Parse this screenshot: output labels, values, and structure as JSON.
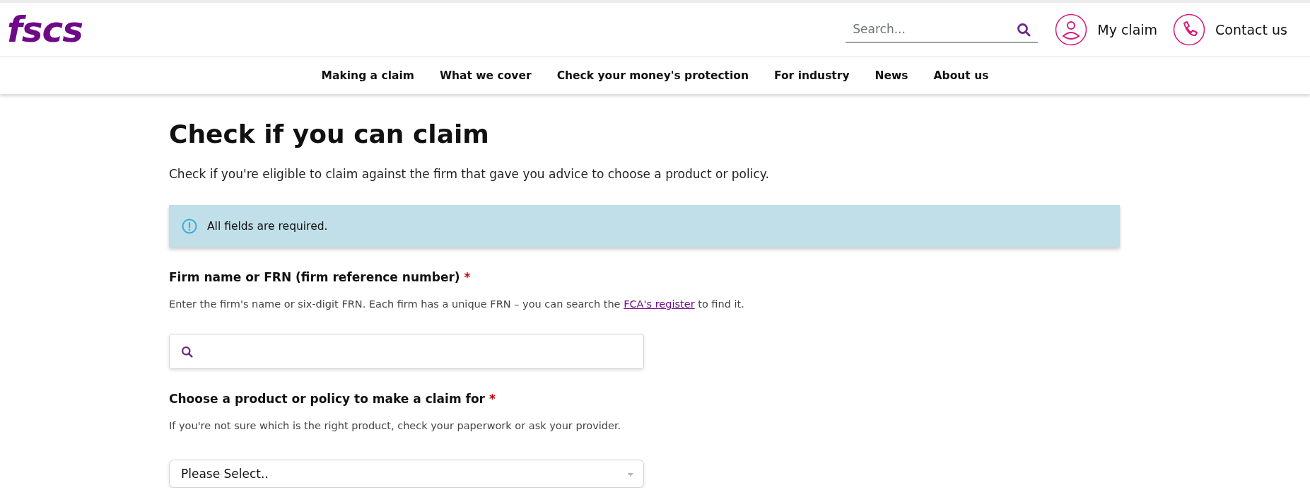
{
  "header": {
    "logo": "fscs",
    "search": {
      "placeholder": "Search..."
    },
    "actions": [
      {
        "kind": "person",
        "label": "My claim"
      },
      {
        "kind": "phone",
        "label": "Contact us"
      }
    ]
  },
  "nav": [
    "Making a claim",
    "What we cover",
    "Check your money's protection",
    "For industry",
    "News",
    "About us"
  ],
  "page": {
    "title": "Check if you can claim",
    "intro": "Check if you're eligible to claim against the firm that gave you advice to choose a product or policy.",
    "alert": "All fields are required.",
    "fields": [
      {
        "kind": "search",
        "label": "Firm name or FRN (firm reference number)",
        "required_mark": "*",
        "hint_before": "Enter the firm's name or six-digit FRN. Each firm has a unique FRN – you can search the ",
        "hint_link": "FCA's register",
        "hint_after": " to find it."
      },
      {
        "kind": "select",
        "label": "Choose a product or policy to make a claim for",
        "required_mark": "*",
        "hint_before": "If you're not sure which is the right product, check your paperwork or ask your provider.",
        "value": "Please Select.."
      }
    ]
  }
}
